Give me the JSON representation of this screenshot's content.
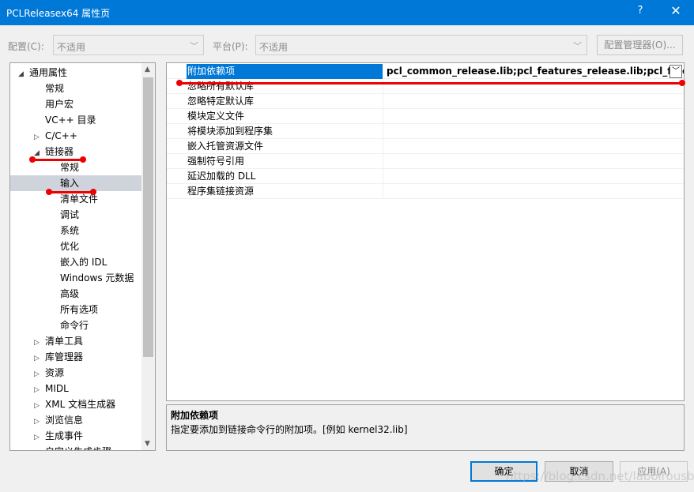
{
  "window": {
    "title": "PCLReleasex64 属性页",
    "help_label": "?",
    "close_label": "✕"
  },
  "config": {
    "config_label": "配置(C):",
    "config_value": "不适用",
    "platform_label": "平台(P):",
    "platform_value": "不适用",
    "manager_button": "配置管理器(O)..."
  },
  "tree": [
    {
      "label": "通用属性",
      "expander": "◢"
    },
    {
      "label": "常规",
      "expander": ""
    },
    {
      "label": "用户宏",
      "expander": ""
    },
    {
      "label": "VC++ 目录",
      "expander": ""
    },
    {
      "label": "C/C++",
      "expander": "▷"
    },
    {
      "label": "链接器",
      "expander": "◢"
    },
    {
      "label": "常规",
      "expander": ""
    },
    {
      "label": "输入",
      "expander": ""
    },
    {
      "label": "清单文件",
      "expander": ""
    },
    {
      "label": "调试",
      "expander": ""
    },
    {
      "label": "系统",
      "expander": ""
    },
    {
      "label": "优化",
      "expander": ""
    },
    {
      "label": "嵌入的 IDL",
      "expander": ""
    },
    {
      "label": "Windows 元数据",
      "expander": ""
    },
    {
      "label": "高级",
      "expander": ""
    },
    {
      "label": "所有选项",
      "expander": ""
    },
    {
      "label": "命令行",
      "expander": ""
    },
    {
      "label": "清单工具",
      "expander": "▷"
    },
    {
      "label": "库管理器",
      "expander": "▷"
    },
    {
      "label": "资源",
      "expander": "▷"
    },
    {
      "label": "MIDL",
      "expander": "▷"
    },
    {
      "label": "XML 文档生成器",
      "expander": "▷"
    },
    {
      "label": "浏览信息",
      "expander": "▷"
    },
    {
      "label": "生成事件",
      "expander": "▷"
    },
    {
      "label": "自定义生成步骤",
      "expander": "▷"
    }
  ],
  "properties": [
    {
      "name": "附加依赖项",
      "value": "pcl_common_release.lib;pcl_features_release.lib;pcl_filters_r"
    },
    {
      "name": "忽略所有默认库",
      "value": ""
    },
    {
      "name": "忽略特定默认库",
      "value": ""
    },
    {
      "name": "模块定义文件",
      "value": ""
    },
    {
      "name": "将模块添加到程序集",
      "value": ""
    },
    {
      "name": "嵌入托管资源文件",
      "value": ""
    },
    {
      "name": "强制符号引用",
      "value": ""
    },
    {
      "name": "延迟加载的 DLL",
      "value": ""
    },
    {
      "name": "程序集链接资源",
      "value": ""
    }
  ],
  "description": {
    "title": "附加依赖项",
    "text": "指定要添加到链接命令行的附加项。[例如 kernel32.lib]"
  },
  "buttons": {
    "ok": "确定",
    "cancel": "取消",
    "apply": "应用(A)"
  },
  "watermark": "https://blog.csdn.net/laboirousbee",
  "icons": {
    "combo_arrow": "chevron-down-icon",
    "dropdown": "chevron-down-icon",
    "scroll_up": "scroll-up-icon",
    "scroll_down": "scroll-down-icon"
  },
  "colors": {
    "titlebar": "#0078d7",
    "selection": "#0078d7",
    "annotation": "#e00000"
  }
}
